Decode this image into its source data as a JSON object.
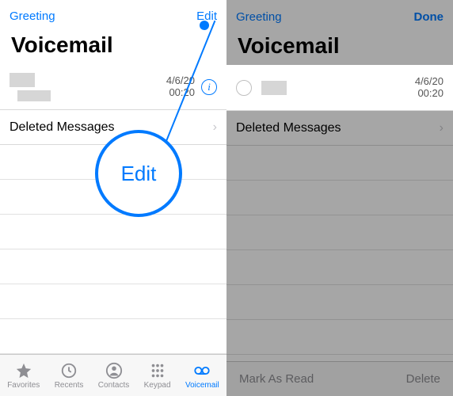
{
  "left": {
    "nav": {
      "left": "Greeting",
      "right": "Edit"
    },
    "title": "Voicemail",
    "vm": {
      "date": "4/6/20",
      "duration": "00:20"
    },
    "deleted_label": "Deleted Messages",
    "tabs": {
      "favorites": "Favorites",
      "recents": "Recents",
      "contacts": "Contacts",
      "keypad": "Keypad",
      "voicemail": "Voicemail"
    },
    "callout": "Edit"
  },
  "right": {
    "nav": {
      "left": "Greeting",
      "right": "Done"
    },
    "title": "Voicemail",
    "vm": {
      "date": "4/6/20",
      "duration": "00:20"
    },
    "deleted_label": "Deleted Messages",
    "toolbar": {
      "mark": "Mark As Read",
      "delete": "Delete"
    }
  }
}
